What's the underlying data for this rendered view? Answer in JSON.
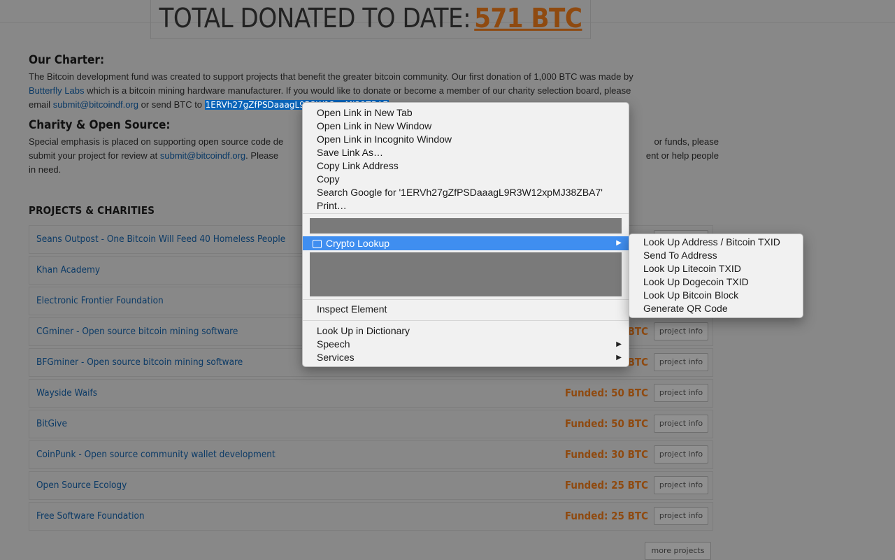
{
  "header": {
    "title": "TOTAL DONATED TO DATE:",
    "amount": "571 BTC"
  },
  "charter": {
    "heading": "Our Charter:",
    "line1": "The Bitcoin development fund was created to support projects that benefit the greater bitcoin community.  Our first donation of 1,000 BTC was made by",
    "link_butterfly": "Butterfly Labs",
    "line2": " which is a bitcoin mining hardware manufacturer.  If you would like to donate or become a member of our charity selection board, please",
    "email_prefix": "email ",
    "email": "submit@bitcoindf.org",
    "send_text": " or send BTC to ",
    "address": "1ERVh27gZfPSDaaagL9R3W12xpMJ38ZBA7"
  },
  "charity": {
    "heading": "Charity & Open Source:",
    "line1a": "Special emphasis is placed on supporting open source code de",
    "line1b": "or funds, please",
    "line2a": "submit your project for review at ",
    "email": "submit@bitcoindf.org",
    "line2b": ". Please",
    "line2c": "ent or help people",
    "line3": "in need."
  },
  "projects": {
    "heading": "PROJECTS & CHARITIES",
    "button_label": "project info",
    "more_label": "more projects",
    "rows": [
      {
        "name": "Seans Outpost - One Bitcoin Will Feed 40 Homeless People",
        "funded": ""
      },
      {
        "name": "Khan Academy",
        "funded": ""
      },
      {
        "name": "Electronic Frontier Foundation",
        "funded": ""
      },
      {
        "name": "CGminer - Open source bitcoin mining software",
        "funded": "BTC"
      },
      {
        "name": "BFGminer - Open source bitcoin mining software",
        "funded": "BTC"
      },
      {
        "name": "Wayside Waifs",
        "funded": "Funded: 50 BTC"
      },
      {
        "name": "BitGive",
        "funded": "Funded: 50 BTC"
      },
      {
        "name": "CoinPunk - Open source community wallet development",
        "funded": "Funded: 30 BTC"
      },
      {
        "name": "Open Source Ecology",
        "funded": "Funded: 25 BTC"
      },
      {
        "name": "Free Software Foundation",
        "funded": "Funded: 25 BTC"
      }
    ]
  },
  "context_menu": {
    "items": [
      "Open Link in New Tab",
      "Open Link in New Window",
      "Open Link in Incognito Window",
      "Save Link As…",
      "Copy Link Address",
      "Copy",
      "Search Google for '1ERVh27gZfPSDaaagL9R3W12xpMJ38ZBA7'",
      "Print…"
    ],
    "crypto_lookup": "Crypto Lookup",
    "inspect": "Inspect Element",
    "dictionary": "Look Up in Dictionary",
    "speech": "Speech",
    "services": "Services"
  },
  "submenu": {
    "items": [
      "Look Up Address / Bitcoin TXID",
      "Send To Address",
      "Look Up Litecoin TXID",
      "Look Up Dogecoin TXID",
      "Look Up Bitcoin Block",
      "Generate QR Code"
    ]
  },
  "colors": {
    "overlay_background": "#888888",
    "funded_orange": "#8f4a10",
    "link_blue": "#0b3a66",
    "menu_highlight": "#3f8ef0"
  }
}
